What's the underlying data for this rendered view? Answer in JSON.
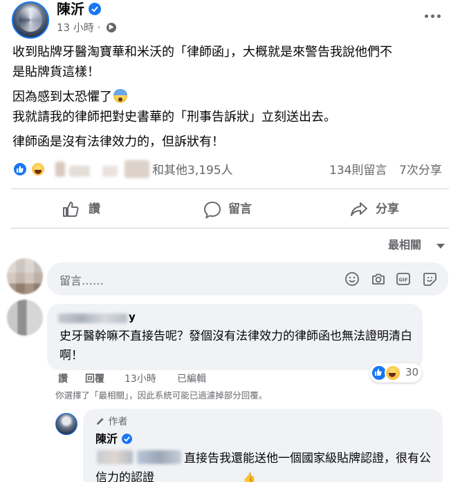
{
  "post": {
    "author": "陳沂",
    "time": "13 小時",
    "dot": "·",
    "lines": [
      "收到貼牌牙醫淘寶華和米沃的「律師函」，大概就是來警告我說他們不",
      "是貼牌貨這樣！",
      "因為感到太恐懼了",
      "我就請我的律師把對史書華的「刑事告訴狀」立刻送出去。",
      "律師函是沒有法律效力的，但訴狀有！"
    ]
  },
  "reactions": {
    "others": "和其他3,195人",
    "comments": "134則留言",
    "shares": "7次分享"
  },
  "actions": {
    "like": "讚",
    "comment": "留言",
    "share": "分享"
  },
  "sort": {
    "label": "最相關"
  },
  "comment_input": {
    "placeholder": "留言……"
  },
  "comment": {
    "author_suffix": "y",
    "text": "史牙醫幹嘛不直接告呢？發個沒有法律效力的律師函也無法證明清白啊！",
    "reaction_count": "30",
    "like": "讚",
    "reply": "回覆",
    "time": "13小時",
    "edited": "已編輯",
    "filter_note": "你選擇了「最相關」，因此系統可能已過濾掉部分回覆。"
  },
  "reply": {
    "tag": "作者",
    "author": "陳沂",
    "text": "直接告我還能送他一個國家級貼牌認證，很有公信力的認證",
    "emoji": "👍"
  },
  "colors": {
    "accent": "#1877f2",
    "secondary_text": "#65676b",
    "bubble": "#f0f2f5"
  }
}
